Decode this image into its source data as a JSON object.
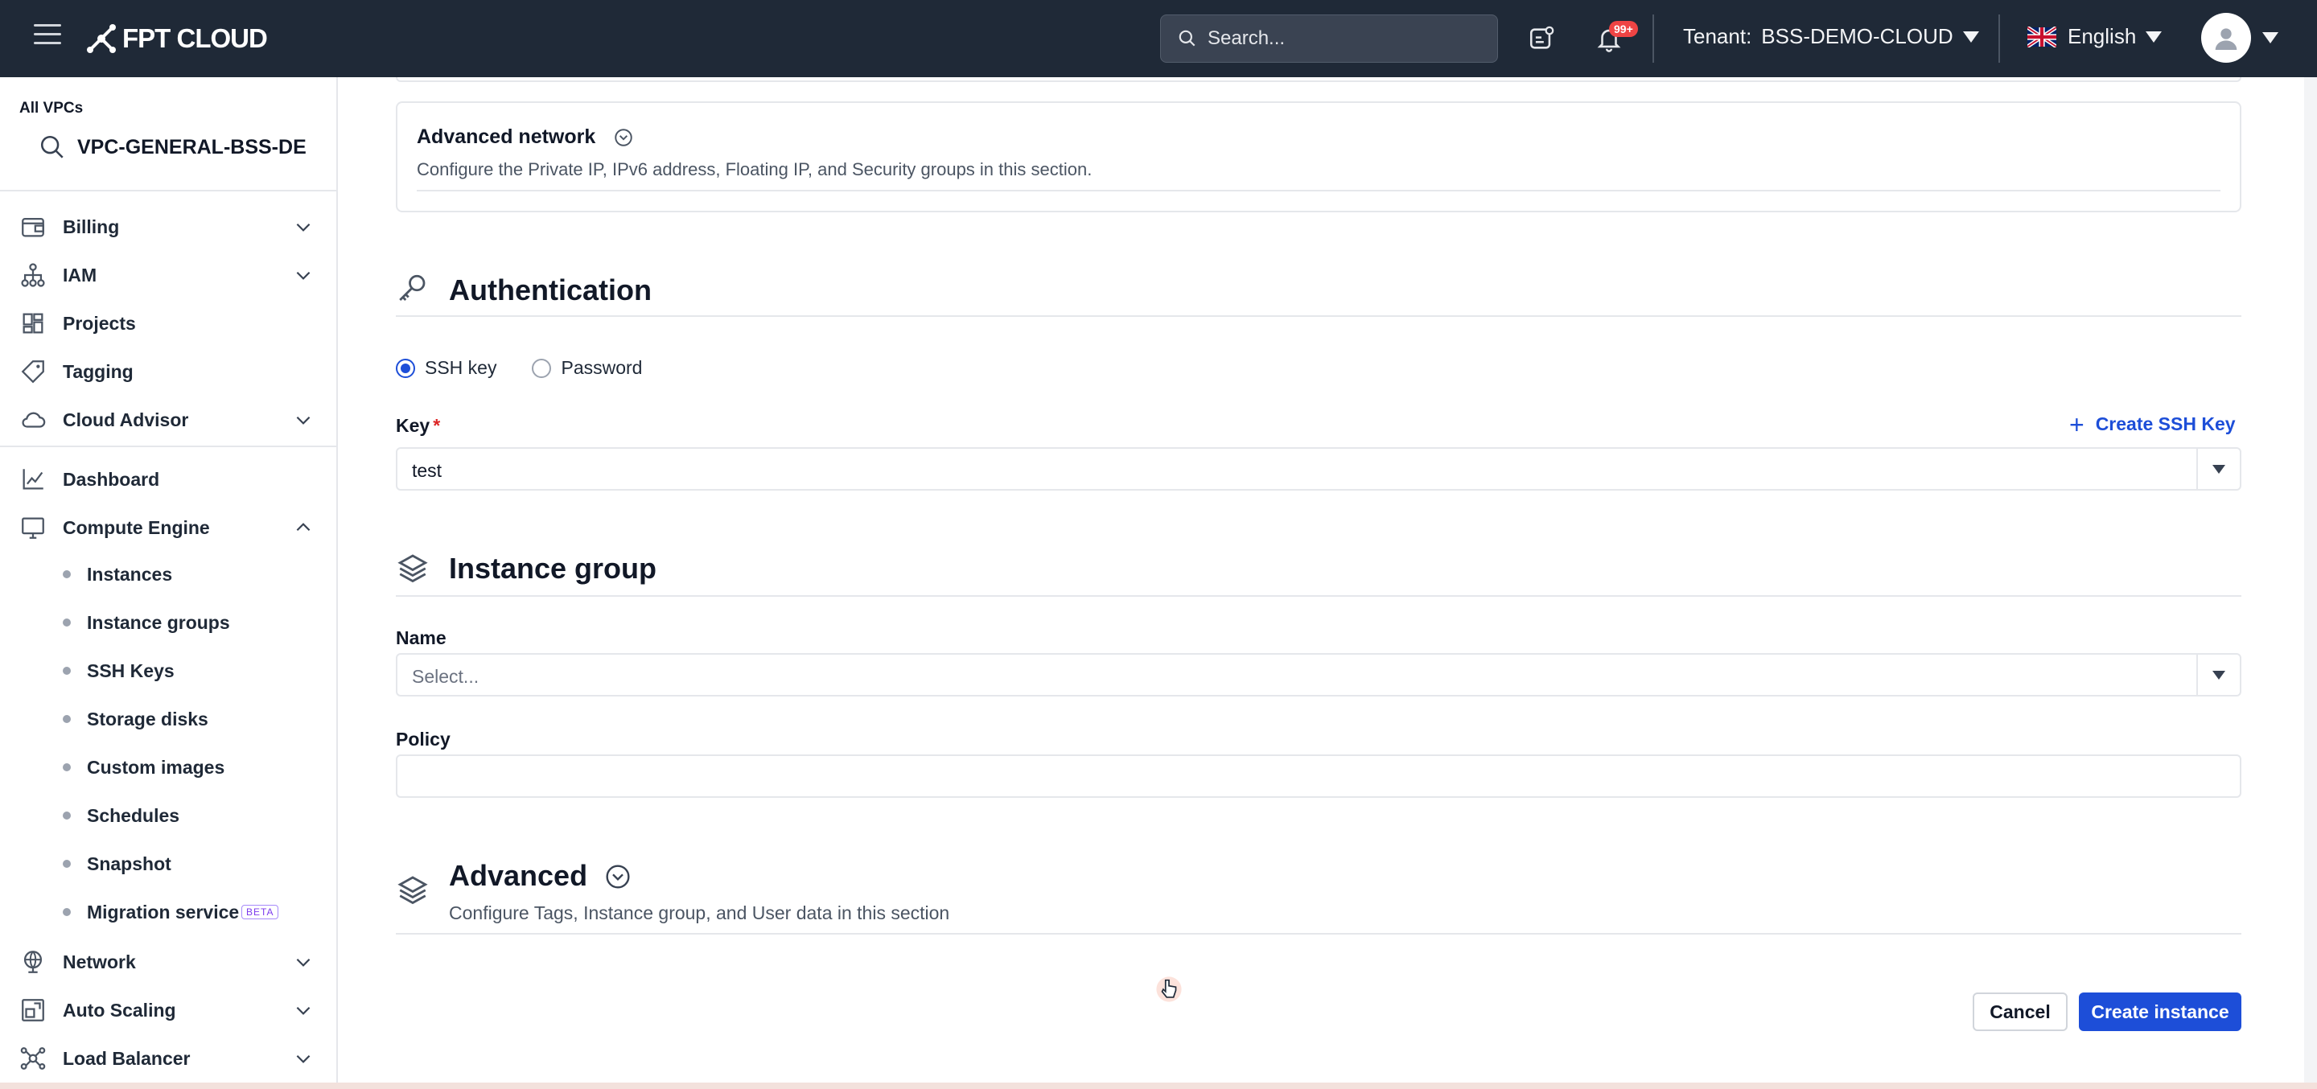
{
  "header": {
    "logo_text": "FPT CLOUD",
    "search_placeholder": "Search...",
    "notification_count": "99+",
    "tenant_label": "Tenant:",
    "tenant_value": "BSS-DEMO-CLOUD",
    "language": "English",
    "icons": [
      "menu-icon",
      "search-icon",
      "message-icon",
      "bell-icon",
      "uk-flag-icon",
      "user-avatar-icon"
    ]
  },
  "sidebar": {
    "vpc_label": "All VPCs",
    "vpc_name": "VPC-GENERAL-BSS-DE",
    "items": [
      {
        "label": "Billing",
        "icon": "wallet-icon"
      },
      {
        "label": "IAM",
        "icon": "hierarchy-icon"
      },
      {
        "label": "Projects",
        "icon": "grid-icon"
      },
      {
        "label": "Tagging",
        "icon": "tag-icon"
      },
      {
        "label": "Cloud Advisor",
        "icon": "cloud-icon"
      },
      {
        "label": "Dashboard",
        "icon": "chart-icon"
      },
      {
        "label": "Compute Engine",
        "icon": "monitor-icon"
      },
      {
        "label": "Network",
        "icon": "globe-icon"
      },
      {
        "label": "Auto Scaling",
        "icon": "scaling-icon"
      },
      {
        "label": "Load Balancer",
        "icon": "balancer-icon"
      }
    ],
    "compute_sub_items": [
      {
        "label": "Instances"
      },
      {
        "label": "Instance groups"
      },
      {
        "label": "SSH Keys"
      },
      {
        "label": "Storage disks"
      },
      {
        "label": "Custom images"
      },
      {
        "label": "Schedules"
      },
      {
        "label": "Snapshot"
      },
      {
        "label": "Migration service",
        "badge": "BETA"
      }
    ]
  },
  "main": {
    "advanced_network": {
      "title": "Advanced network",
      "description": "Configure the Private IP, IPv6 address, Floating IP, and Security groups in this section."
    },
    "authentication": {
      "title": "Authentication",
      "options": [
        "SSH key",
        "Password"
      ],
      "selected": "SSH key",
      "key_label": "Key",
      "required_mark": "*",
      "create_ssh_key": "Create SSH Key",
      "key_value": "test"
    },
    "instance_group": {
      "title": "Instance group",
      "name_label": "Name",
      "name_placeholder": "Select...",
      "policy_label": "Policy",
      "policy_value": ""
    },
    "advanced": {
      "title": "Advanced",
      "description": "Configure Tags, Instance group, and User data in this section"
    },
    "actions": {
      "cancel": "Cancel",
      "create": "Create instance"
    }
  },
  "colors": {
    "topbar": "#1f2937",
    "primary": "#1d4ed8",
    "required": "#dc2626",
    "badge": "#ef4444"
  }
}
